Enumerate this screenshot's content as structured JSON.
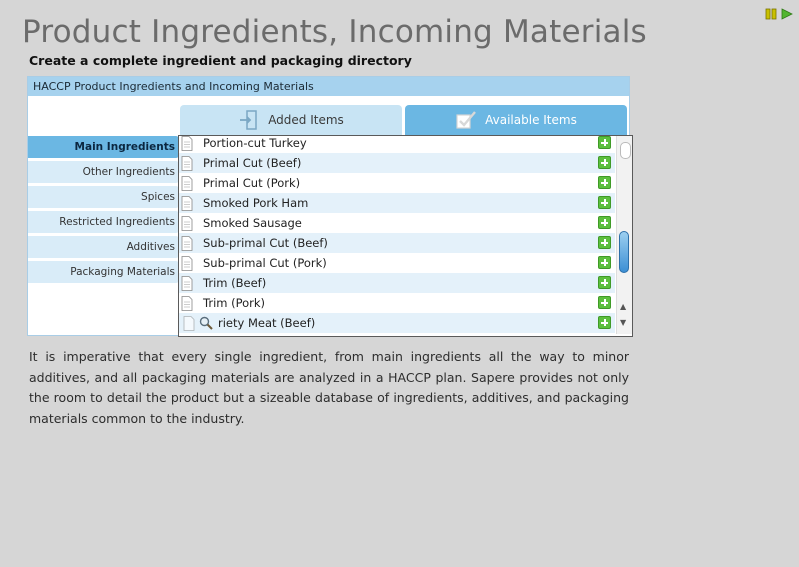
{
  "page": {
    "title": "Product Ingredients, Incoming Materials",
    "subtitle": "Create a complete ingredient and packaging directory",
    "description": "It is imperative that every single ingredient, from main ingredients all the way to minor additives, and all packaging materials are analyzed in a HACCP plan. Sapere provides not only the room to detail the product but a sizeable database of ingredients, additives, and packaging materials common to the industry."
  },
  "controls": {
    "pause_icon": "pause-icon",
    "play_icon": "play-icon"
  },
  "panel": {
    "header": "HACCP Product Ingredients and Incoming Materials",
    "tabs": [
      {
        "label": "Added Items",
        "icon": "door-enter-icon",
        "active": false
      },
      {
        "label": "Available Items",
        "icon": "checkbox-checked-icon",
        "active": true
      }
    ],
    "categories": [
      {
        "label": "Main Ingredients",
        "active": true
      },
      {
        "label": "Other Ingredients",
        "active": false
      },
      {
        "label": "Spices",
        "active": false
      },
      {
        "label": "Restricted Ingredients",
        "active": false
      },
      {
        "label": "Additives",
        "active": false
      },
      {
        "label": "Packaging Materials",
        "active": false
      }
    ],
    "items": [
      "Portion-cut Turkey",
      "Primal Cut (Beef)",
      "Primal Cut (Pork)",
      "Smoked Pork Ham",
      "Smoked Sausage",
      "Sub-primal Cut (Beef)",
      "Sub-primal Cut (Pork)",
      "Trim (Beef)",
      "Trim (Pork)",
      "riety Meat (Beef)"
    ]
  },
  "colors": {
    "accent": "#6bb7e3",
    "header": "#a6d2ee",
    "add_button": "#5cbf3e"
  }
}
